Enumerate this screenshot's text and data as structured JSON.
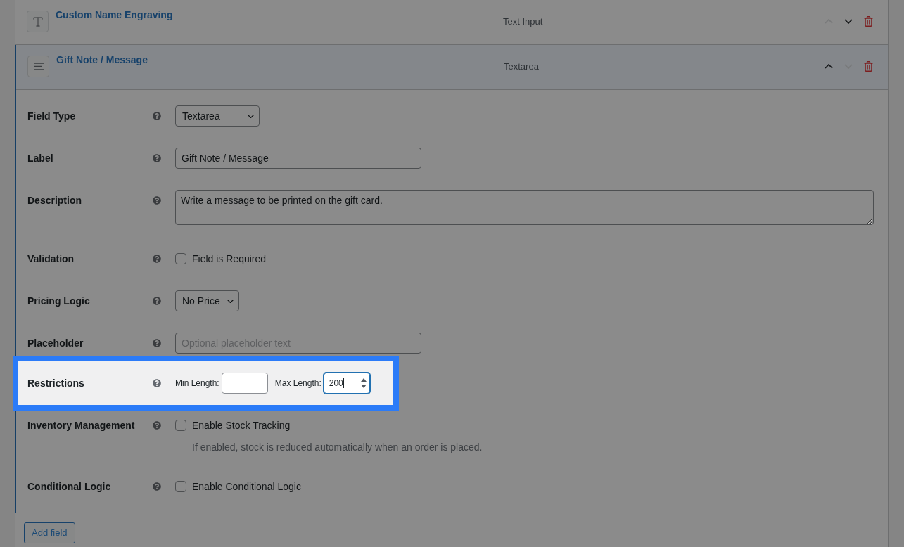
{
  "fields": [
    {
      "kind": "text_input",
      "title": "Custom Name Engraving",
      "type": "Text Input",
      "expanded": false,
      "move_up_disabled": true,
      "move_down_disabled": false
    },
    {
      "kind": "textarea",
      "title": "Gift Note / Message",
      "type": "Textarea",
      "expanded": true,
      "move_up_disabled": false,
      "move_down_disabled": true,
      "settings": [
        {
          "kind": "select",
          "label": "Field Type",
          "value": "Textarea",
          "highlighted": false
        },
        {
          "kind": "text",
          "label": "Label",
          "value": "Gift Note / Message",
          "highlighted": false
        },
        {
          "kind": "textarea",
          "label": "Description",
          "value": "Write a message to be printed on the gift card.",
          "highlighted": false
        },
        {
          "kind": "checkbox",
          "label": "Validation",
          "option": "Field is Required",
          "checked": false,
          "highlighted": false
        },
        {
          "kind": "select",
          "label": "Pricing Logic",
          "value": "No Price",
          "highlighted": false
        },
        {
          "kind": "text",
          "label": "Placeholder",
          "placeholder": "Optional placeholder text",
          "highlighted": false
        },
        {
          "kind": "length_range",
          "label": "Restrictions",
          "highlighted": true,
          "min": {
            "label": "Min Length:",
            "focused": false
          },
          "max": {
            "label": "Max Length:",
            "value": "200",
            "focused": true
          }
        },
        {
          "kind": "checkbox",
          "label": "Inventory Management",
          "option": "Enable Stock Tracking",
          "checked": false,
          "hint": "If enabled, stock is reduced automatically when an order is placed.",
          "highlighted": false
        },
        {
          "kind": "checkbox",
          "label": "Conditional Logic",
          "option": "Enable Conditional Logic",
          "checked": false,
          "highlighted": false
        }
      ]
    }
  ],
  "add_button": "Add field"
}
